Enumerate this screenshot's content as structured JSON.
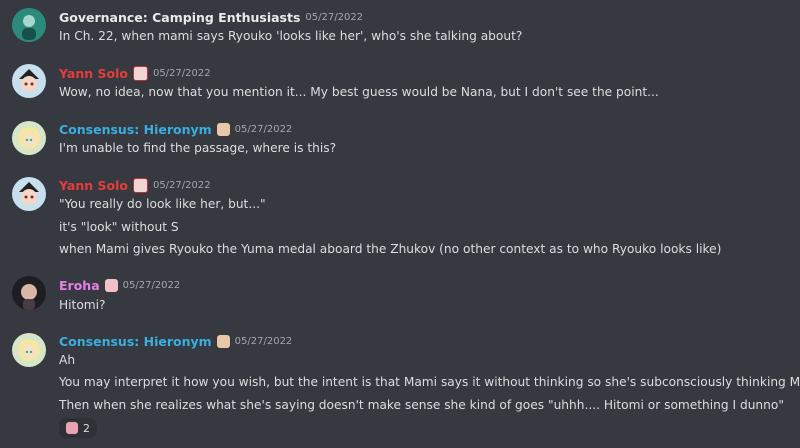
{
  "messages": [
    {
      "username": "Governance: Camping Enthusiasts",
      "name_color": "#e9e9ea",
      "timestamp": "05/27/2022",
      "badge": "",
      "lines": [
        "In Ch. 22, when mami says Ryouko 'looks like her', who's she talking about?"
      ]
    },
    {
      "username": "Yann Solo",
      "name_color": "#e63c3c",
      "timestamp": "05/27/2022",
      "badge": "pirate-badge-icon",
      "lines": [
        "Wow, no idea, now that you mention it... My best guess would be Nana, but I don't see the point..."
      ]
    },
    {
      "username": "Consensus: Hieronym",
      "name_color": "#3aaee0",
      "timestamp": "05/27/2022",
      "badge": "character-badge-icon",
      "lines": [
        "I'm unable to find the passage, where is this?"
      ]
    },
    {
      "username": "Yann Solo",
      "name_color": "#e63c3c",
      "timestamp": "05/27/2022",
      "badge": "pirate-badge-icon",
      "lines": [
        "\"You really do look like her, but...\"",
        "it's \"look\" without S",
        "when Mami gives Ryouko the Yuma medal aboard the Zhukov (no other context as to who Ryouko looks like)"
      ]
    },
    {
      "username": "Eroha",
      "name_color": "#e680e6",
      "timestamp": "05/27/2022",
      "badge": "character-badge-icon",
      "lines": [
        "Hitomi?"
      ]
    },
    {
      "username": "Consensus: Hieronym",
      "name_color": "#3aaee0",
      "timestamp": "05/27/2022",
      "badge": "character-badge-icon",
      "lines": [
        "Ah",
        "You may interpret it how you wish, but the intent is that Mami says it without thinking so she's subconsciously thinking Madoka",
        "Then when she realizes what she's saying doesn't make sense she kind of goes \"uhhh.... Hitomi or something I dunno\""
      ],
      "reaction": {
        "emoji": "character-emoji-icon",
        "count": "2"
      }
    }
  ]
}
